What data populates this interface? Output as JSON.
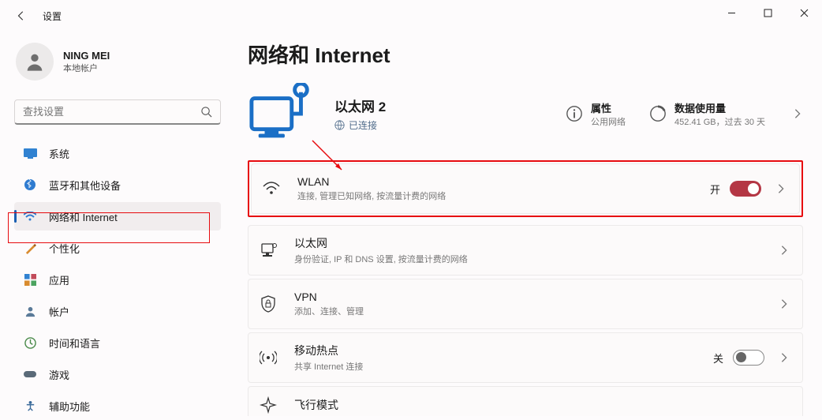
{
  "window": {
    "title": "设置"
  },
  "user": {
    "name": "NING MEI",
    "subtitle": "本地帐户"
  },
  "search": {
    "placeholder": "查找设置"
  },
  "sidebar": {
    "items": [
      {
        "label": "系统"
      },
      {
        "label": "蓝牙和其他设备"
      },
      {
        "label": "网络和 Internet"
      },
      {
        "label": "个性化"
      },
      {
        "label": "应用"
      },
      {
        "label": "帐户"
      },
      {
        "label": "时间和语言"
      },
      {
        "label": "游戏"
      },
      {
        "label": "辅助功能"
      }
    ]
  },
  "page": {
    "title": "网络和 Internet",
    "status": {
      "name": "以太网 2",
      "state": "已连接",
      "props_label": "属性",
      "props_sub": "公用网络",
      "usage_label": "数据使用量",
      "usage_sub": "452.41 GB，过去 30 天"
    },
    "rows": {
      "wlan": {
        "title": "WLAN",
        "sub": "连接, 管理已知网络, 按流量计费的网络",
        "state": "开"
      },
      "ethernet": {
        "title": "以太网",
        "sub": "身份验证, IP 和 DNS 设置, 按流量计费的网络"
      },
      "vpn": {
        "title": "VPN",
        "sub": "添加、连接、管理"
      },
      "hotspot": {
        "title": "移动热点",
        "sub": "共享 Internet 连接",
        "state": "关"
      },
      "airplane": {
        "title": "飞行模式"
      }
    }
  }
}
